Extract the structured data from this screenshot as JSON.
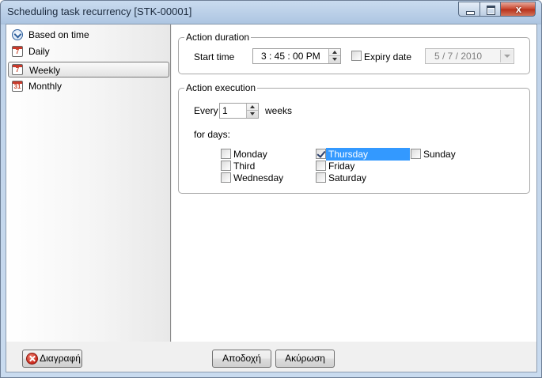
{
  "window": {
    "title": "Scheduling task recurrency [STK-00001]",
    "close_glyph": "x"
  },
  "sidebar": {
    "items": [
      {
        "label": "Based on time",
        "icon": "clock-icon"
      },
      {
        "label": "Daily",
        "icon": "calendar-icon",
        "icon_text": "7"
      },
      {
        "label": "Weekly",
        "icon": "calendar-icon",
        "icon_text": "7",
        "selected": true
      },
      {
        "label": "Monthly",
        "icon": "calendar-icon",
        "icon_text": "31"
      }
    ]
  },
  "duration": {
    "group_title": "Action duration",
    "start_label": "Start time",
    "start_time": "3 : 45 : 00  PM",
    "expiry_label": "Expiry date",
    "expiry_checked": false,
    "expiry_date": "5 /   7 / 2010"
  },
  "execution": {
    "group_title": "Action execution",
    "every_label": "Every",
    "every_value": "1",
    "weeks_label": "weeks",
    "days_label": "for days:",
    "days": [
      {
        "label": "Monday",
        "checked": false
      },
      {
        "label": "Third",
        "checked": false
      },
      {
        "label": "Wednesday",
        "checked": false
      },
      {
        "label": "Thursday",
        "checked": true,
        "selected": true
      },
      {
        "label": "Friday",
        "checked": false
      },
      {
        "label": "Saturday",
        "checked": false
      },
      {
        "label": "Sunday",
        "checked": false
      }
    ]
  },
  "buttons": {
    "delete": "Διαγραφή",
    "accept": "Αποδοχή",
    "cancel": "Ακύρωση"
  },
  "colors": {
    "selection": "#3399ff",
    "title_bar": "#bcd0e7",
    "close_button": "#c8452d"
  }
}
